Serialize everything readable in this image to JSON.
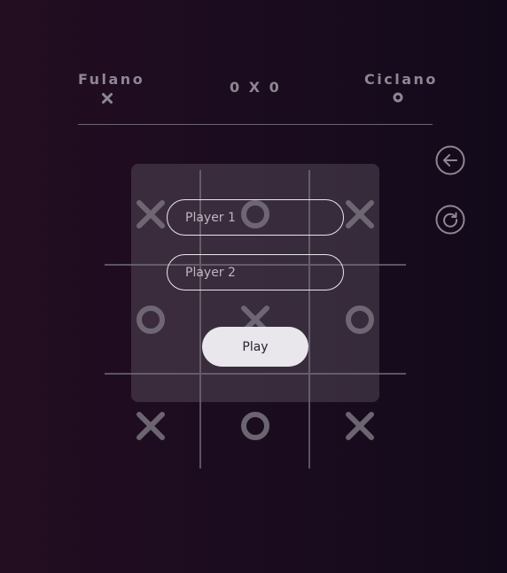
{
  "scoreboard": {
    "player1": {
      "name": "Fulano",
      "mark": "x"
    },
    "player2": {
      "name": "Ciclano",
      "mark": "o"
    },
    "score": "0 X 0"
  },
  "controls": {
    "back_icon": "arrow-left-circle-icon",
    "restart_icon": "rotate-cw-circle-icon"
  },
  "board": {
    "cells": [
      "x",
      "o",
      "x",
      "o",
      "x",
      "o",
      "x",
      "o",
      "x"
    ]
  },
  "setup_dialog": {
    "player1_placeholder": "Player 1",
    "player2_placeholder": "Player 2",
    "play_label": "Play"
  },
  "colors": {
    "background_left": "#230d21",
    "background_right": "#120a1a",
    "mark": "#6b6570",
    "text": "#8e8691",
    "button_bg": "#e9e6ec"
  }
}
